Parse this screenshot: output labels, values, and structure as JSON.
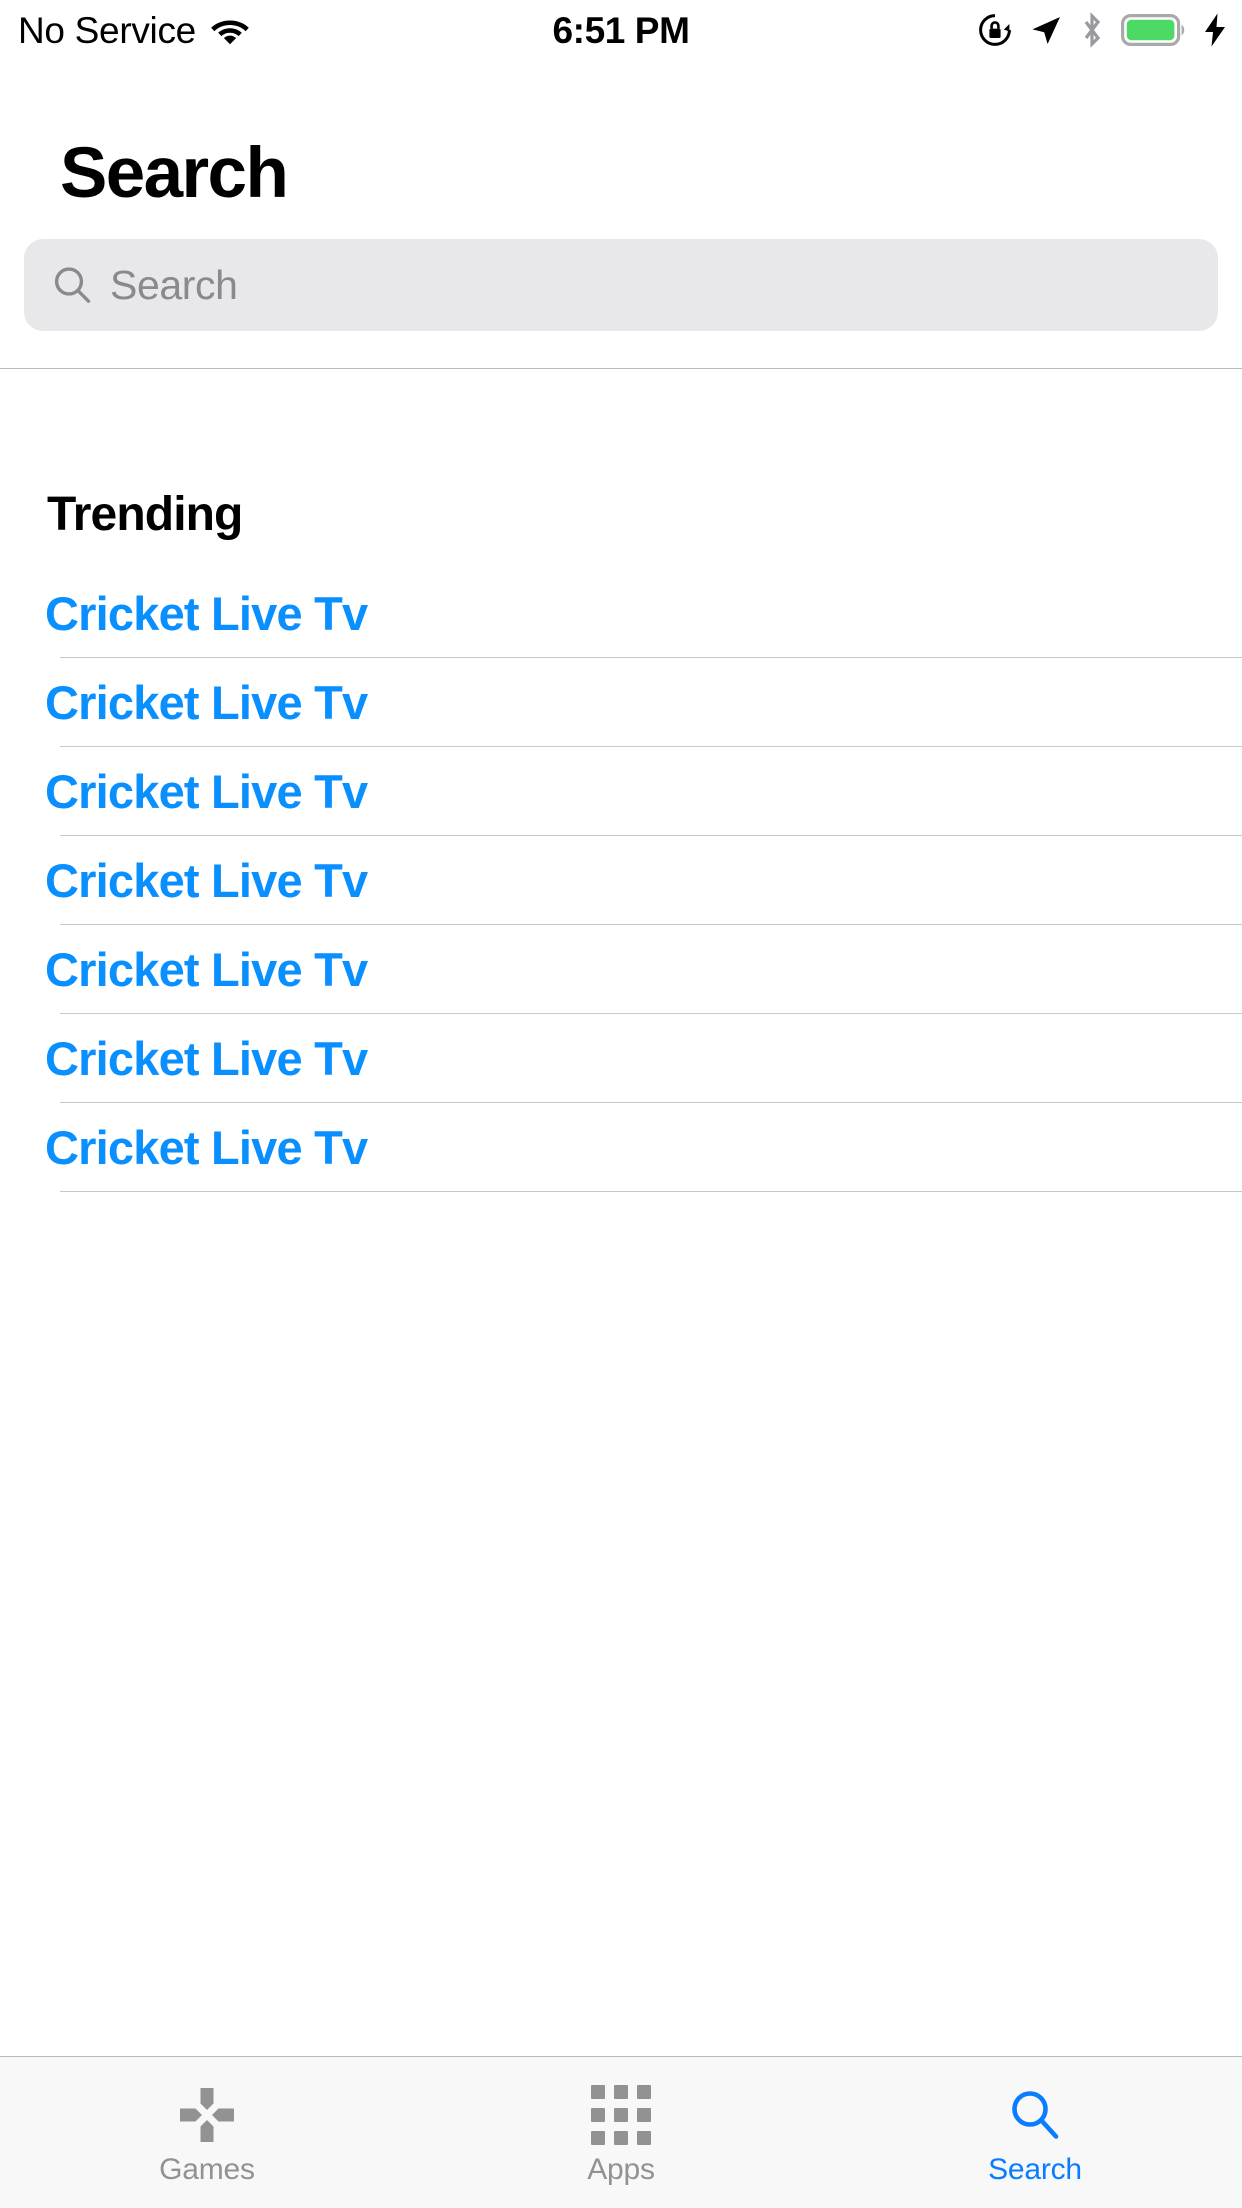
{
  "status_bar": {
    "carrier": "No Service",
    "wifi_icon": "wifi-icon",
    "time": "6:51 PM",
    "right_icons": [
      "rotation-lock-icon",
      "location-arrow-icon",
      "bluetooth-icon",
      "battery-icon",
      "charging-bolt-icon"
    ],
    "battery_color": "#4CD964",
    "bluetooth_color": "#8e8e93"
  },
  "header": {
    "title": "Search"
  },
  "search": {
    "value": "",
    "placeholder": "Search",
    "icon": "search-icon",
    "background": "#E8E8EA"
  },
  "main": {
    "section_title": "Trending",
    "trending": [
      {
        "label": "Cricket Live Tv"
      },
      {
        "label": "Cricket Live Tv"
      },
      {
        "label": "Cricket Live Tv"
      },
      {
        "label": "Cricket Live Tv"
      },
      {
        "label": "Cricket Live Tv"
      },
      {
        "label": "Cricket Live Tv"
      },
      {
        "label": "Cricket Live Tv"
      }
    ],
    "link_color": "#0A8FFF"
  },
  "tab_bar": {
    "active_color": "#0A7CFF",
    "inactive_color": "#929292",
    "items": [
      {
        "label": "Games",
        "icon": "dpad-icon",
        "active": false
      },
      {
        "label": "Apps",
        "icon": "grid-icon",
        "active": false
      },
      {
        "label": "Search",
        "icon": "search-icon",
        "active": true
      }
    ]
  }
}
